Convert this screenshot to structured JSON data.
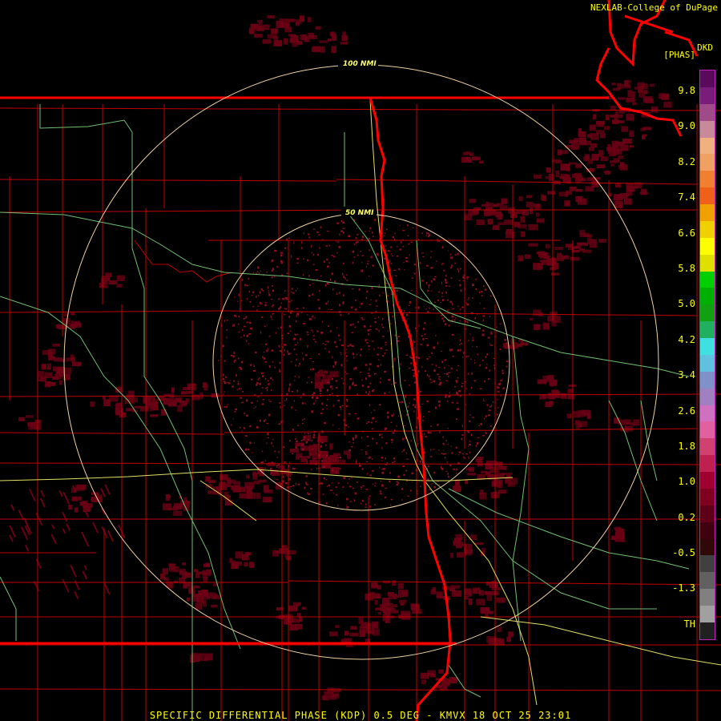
{
  "header": {
    "credit": "NEXLAB-College of DuPage",
    "product_code": "DKD",
    "units": "[PHAS]"
  },
  "footer": {
    "caption": "SPECIFIC DIFFERENTIAL PHASE (KDP) 0.5 DEG - KMVX 18 OCT 25 23:01"
  },
  "range_rings": [
    {
      "label": "100 NMI"
    },
    {
      "label": "50 NMI"
    }
  ],
  "legend": {
    "ticks": [
      "9.8",
      "9.0",
      "8.2",
      "7.4",
      "6.6",
      "5.8",
      "5.0",
      "4.2",
      "3.4",
      "2.6",
      "1.8",
      "1.0",
      "0.2",
      "-0.5",
      "-1.3",
      "TH"
    ],
    "colors": [
      "#5a0a5a",
      "#7a1c7a",
      "#a04a8a",
      "#c88a9a",
      "#f0b080",
      "#f0a060",
      "#f08030",
      "#f06018",
      "#f0a000",
      "#f0d000",
      "#ffff00",
      "#e0e000",
      "#00d000",
      "#00b000",
      "#10a010",
      "#20b060",
      "#40e0e0",
      "#60c0e0",
      "#8090c8",
      "#a080c0",
      "#d070c0",
      "#e060a0",
      "#d04070",
      "#c02050",
      "#a00030",
      "#800020",
      "#600018",
      "#400010",
      "#300808",
      "#404040",
      "#606060",
      "#808080",
      "#a0a0a0",
      "#202020"
    ]
  },
  "colors": {
    "county_lines": "#c00000",
    "state_lines": "#ff0000",
    "highways": "#70c070",
    "interstates": "#e0e060",
    "rings": "#f0d0a0",
    "echo": "#6a0014",
    "speckle": "#8a1020",
    "text": "#ffff00"
  }
}
